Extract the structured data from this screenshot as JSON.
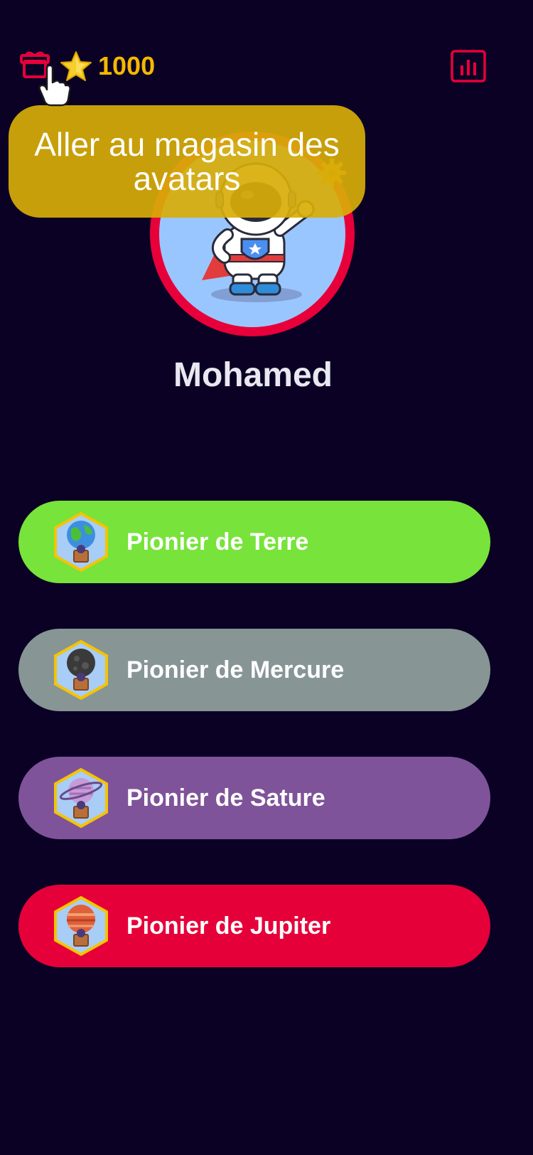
{
  "header": {
    "coins": "1000",
    "shop_icon": "gift-box-icon",
    "stats_icon": "bar-chart-icon",
    "star_icon": "star-icon"
  },
  "tooltip": {
    "text": "Aller au magasin des avatars"
  },
  "profile": {
    "name": "Mohamed",
    "avatar": "astronaut-superhero-avatar"
  },
  "levels": [
    {
      "label": "Pionier de Terre",
      "color": "#77e33b",
      "planet": "earth-balloon-icon"
    },
    {
      "label": "Pionier de Mercure",
      "color": "#879595",
      "planet": "mercury-balloon-icon"
    },
    {
      "label": "Pionier de Sature",
      "color": "#7f5399",
      "planet": "saturn-balloon-icon"
    },
    {
      "label": "Pionier de Jupiter",
      "color": "#e6003a",
      "planet": "jupiter-balloon-icon"
    }
  ],
  "colors": {
    "background": "#0a0125",
    "accent_red": "#e8003a",
    "coin_yellow": "#f5b800",
    "tooltip": "#d8ac08"
  }
}
